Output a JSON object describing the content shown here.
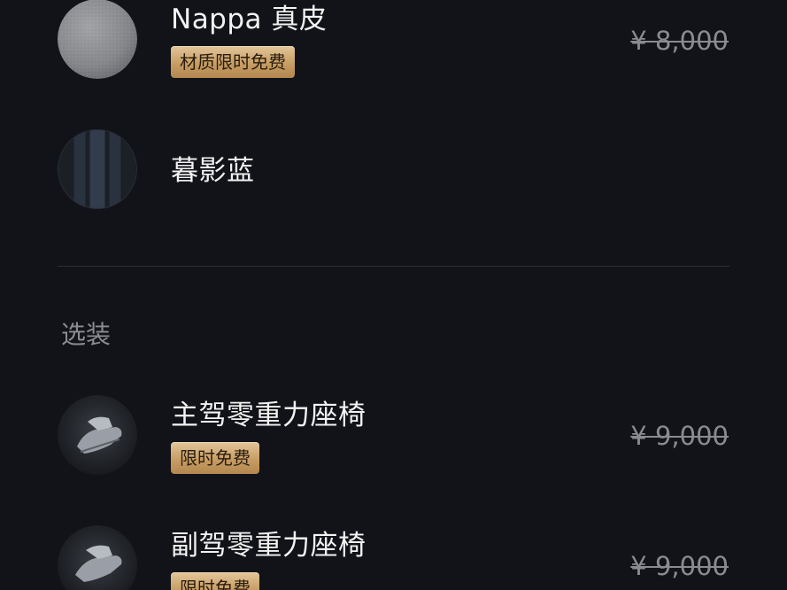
{
  "materials": [
    {
      "thumb_icon": "gray-leather-swatch-icon",
      "title": "Nappa 真皮",
      "badge": "材质限时免费",
      "price": "¥ 8,000"
    },
    {
      "thumb_icon": "dark-blue-seat-swatch-icon",
      "title": "暮影蓝"
    }
  ],
  "options_section": {
    "label": "选装",
    "items": [
      {
        "thumb_icon": "driver-seat-icon",
        "title": "主驾零重力座椅",
        "badge": "限时免费",
        "price": "¥ 9,000"
      },
      {
        "thumb_icon": "passenger-seat-icon",
        "title": "副驾零重力座椅",
        "badge": "限时免费",
        "price": "¥ 9,000"
      }
    ]
  },
  "colors": {
    "background": "#121318",
    "badge_gold": "#c79d63",
    "text_primary": "#f2f2f2",
    "text_muted": "#8a8b90"
  }
}
